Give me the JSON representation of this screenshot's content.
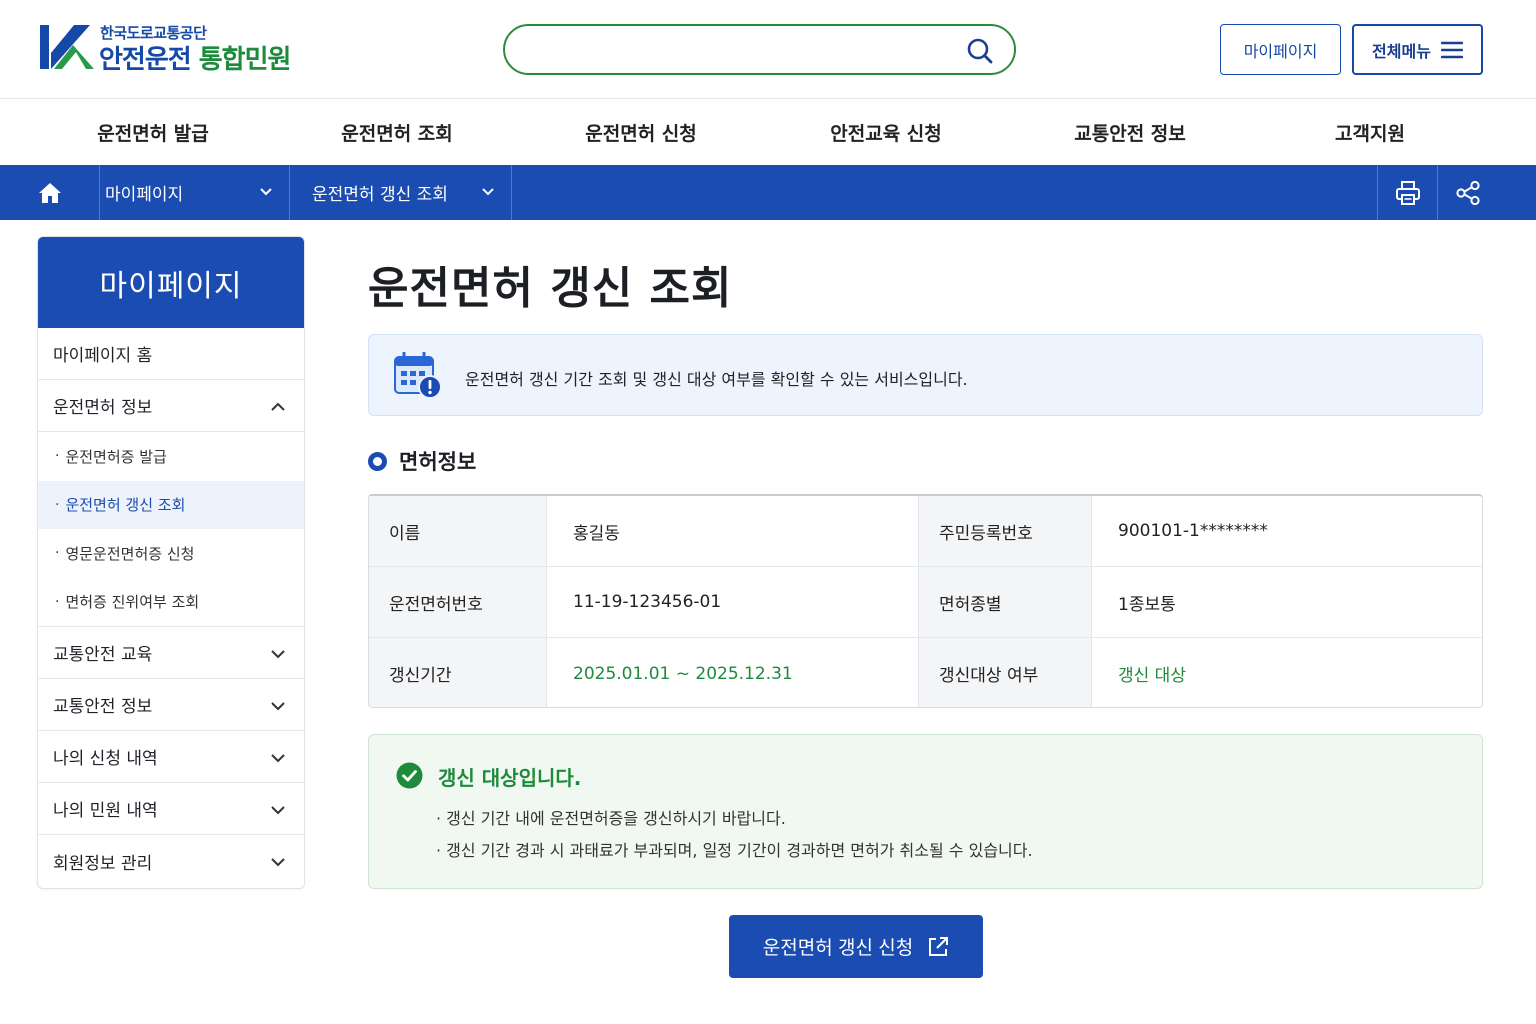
{
  "header": {
    "org_name": "한국도로교통공단",
    "service_name_a": "안전운전",
    "service_name_b": "통합민원",
    "search_value": "",
    "mypage_label": "마이페이지",
    "allmenu_label": "전체메뉴"
  },
  "gnb": [
    "운전면허 발급",
    "운전면허 조회",
    "운전면허 신청",
    "안전교육 신청",
    "교통안전 정보",
    "고객지원"
  ],
  "location": {
    "level1": "마이페이지",
    "level2": "운전면허 갱신 조회"
  },
  "sidebar": {
    "title": "마이페이지",
    "home": "마이페이지 홈",
    "license_info": "운전면허 정보",
    "sub_items": [
      {
        "label": "운전면허증 발급",
        "active": false
      },
      {
        "label": "운전면허 갱신 조회",
        "active": true
      },
      {
        "label": "영문운전면허증 신청",
        "active": false
      },
      {
        "label": "면허증 진위여부 조회",
        "active": false
      }
    ],
    "groups": [
      "교통안전 교육",
      "교통안전 정보",
      "나의 신청 내역",
      "나의 민원 내역",
      "회원정보 관리"
    ]
  },
  "main": {
    "title": "운전면허 갱신 조회",
    "info_text": "운전면허 갱신 기간 조회 및 갱신 대상 여부를 확인할 수 있는 서비스입니다.",
    "section_title": "면허정보",
    "table": {
      "name_label": "이름",
      "name_value": "홍길동",
      "rrn_label": "주민등록번호",
      "rrn_value": "900101-1********",
      "license_no_label": "운전면허번호",
      "license_no_value": "11-19-123456-01",
      "license_type_label": "면허종별",
      "license_type_value": "1종보통",
      "period_label": "갱신기간",
      "period_value": "2025.01.01 ~ 2025.12.31",
      "target_label": "갱신대상 여부",
      "target_value": "갱신 대상"
    },
    "status": {
      "title": "갱신 대상입니다.",
      "line1": "· 갱신 기간 내에 운전면허증을 갱신하시기 바랍니다.",
      "line2": "· 갱신 기간 경과 시 과태료가 부과되며, 일정 기간이 경과하면 면허가 취소될 수 있습니다."
    },
    "apply_button": "운전면허 갱신 신청"
  },
  "colors": {
    "primary": "#1a4cb1",
    "success": "#1e8a3c",
    "info_bg": "#eef4fd",
    "success_bg": "#f1f8f1"
  },
  "icons": [
    "home-icon",
    "chevron-down-icon",
    "print-icon",
    "share-icon",
    "search-icon",
    "hamburger-icon",
    "calendar-alert-icon",
    "check-circle-icon",
    "external-link-icon",
    "chevron-up-icon"
  ]
}
